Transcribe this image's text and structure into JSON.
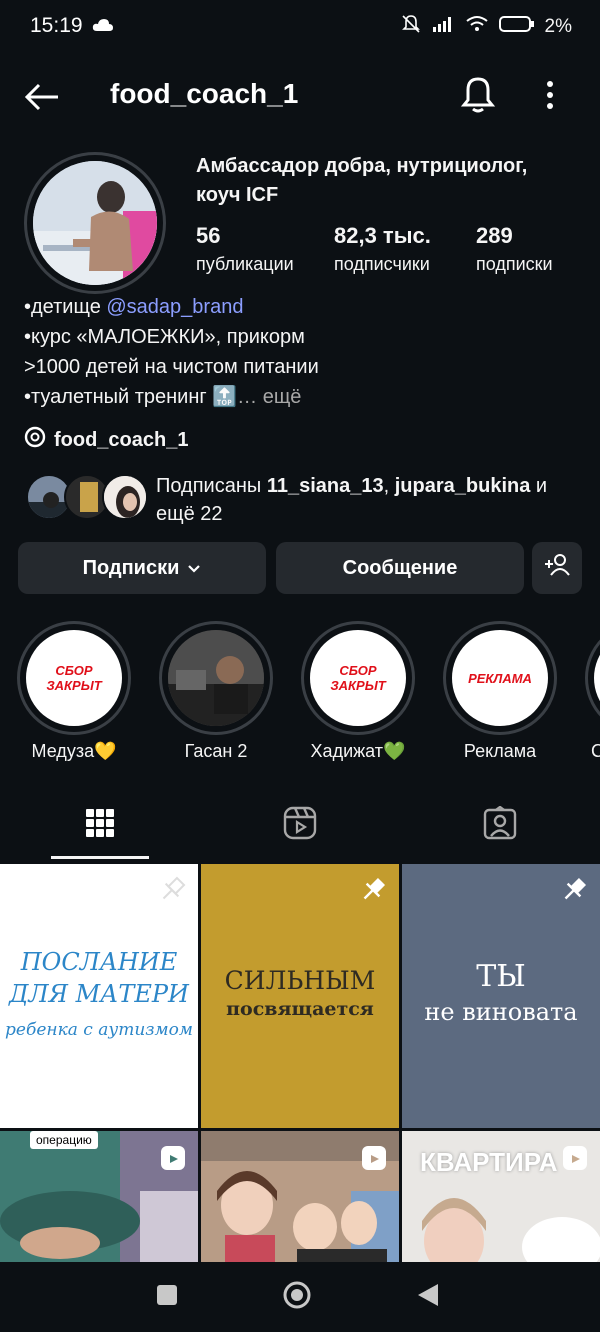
{
  "status": {
    "time": "15:19",
    "battery": "2%"
  },
  "header": {
    "username": "food_coach_1"
  },
  "profile": {
    "name": "Амбассадор добра, нутрициолог, коуч ICF",
    "stats": [
      {
        "value": "56",
        "label": "публикации"
      },
      {
        "value": "82,3 тыс.",
        "label": "подписчики"
      },
      {
        "value": "289",
        "label": "подписки"
      }
    ],
    "bio": {
      "line1_prefix": "•детище ",
      "line1_link": "@sadap_brand",
      "line2": "•курс «МАЛОЕЖКИ», прикорм",
      "line3": ">1000 детей на чистом питании",
      "line4_prefix": "•туалетный тренинг ",
      "line4_emoji": "🔝",
      "line4_more": "… ещё"
    },
    "threads_handle": "food_coach_1",
    "followed_by": {
      "prefix": "Подписаны ",
      "user1": "11_siana_13",
      "sep": ", ",
      "user2": "jupara_bukina",
      "suffix": " и ещё 22"
    }
  },
  "actions": {
    "following": "Подписки",
    "message": "Сообщение"
  },
  "highlights": [
    {
      "label": "Медуза💛",
      "cover_text": "СБОР\nЗАКРЫТ"
    },
    {
      "label": "Гасан 2",
      "cover_text": ""
    },
    {
      "label": "Хадижат💚",
      "cover_text": "СБОР\nЗАКРЫТ"
    },
    {
      "label": "Реклама",
      "cover_text": "РЕКЛАМА"
    },
    {
      "label": "С",
      "cover_text": ""
    }
  ],
  "grid": {
    "post1": {
      "line1": "ПОСЛАНИЕ",
      "line2": "ДЛЯ МАТЕРИ",
      "line3": "ребенка с аутизмом"
    },
    "post2": {
      "line1": "СИЛЬНЫМ",
      "line2": "посвящается"
    },
    "post3": {
      "line1": "ТЫ",
      "line2": "не виновата"
    },
    "post4": {
      "caption": "операцию"
    },
    "post6": {
      "caption": "КВАРТИРА"
    }
  },
  "colors": {
    "background": "#0c1014",
    "button": "#25292e",
    "link": "#8c9eff",
    "accent_red": "#e0101a",
    "post2_bg": "#c39c2e",
    "post3_bg": "#5c6a80"
  }
}
